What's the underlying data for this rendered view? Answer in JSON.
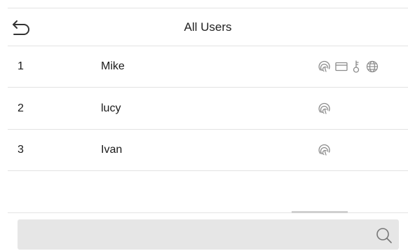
{
  "header": {
    "title": "All Users",
    "back_icon": "back-arrow-icon"
  },
  "users": [
    {
      "id": "1",
      "name": "Mike",
      "credentials": [
        "fingerprint-icon",
        "card-icon",
        "password-key-icon",
        "face-icon"
      ]
    },
    {
      "id": "2",
      "name": "lucy",
      "credentials": [
        "fingerprint-icon"
      ]
    },
    {
      "id": "3",
      "name": "Ivan",
      "credentials": [
        "fingerprint-icon"
      ]
    }
  ],
  "search": {
    "icon": "search-icon",
    "value": ""
  },
  "colors": {
    "icon_gray": "#8c8c8c",
    "divider": "#e3e3e3",
    "search_bg": "#e6e6e6"
  }
}
